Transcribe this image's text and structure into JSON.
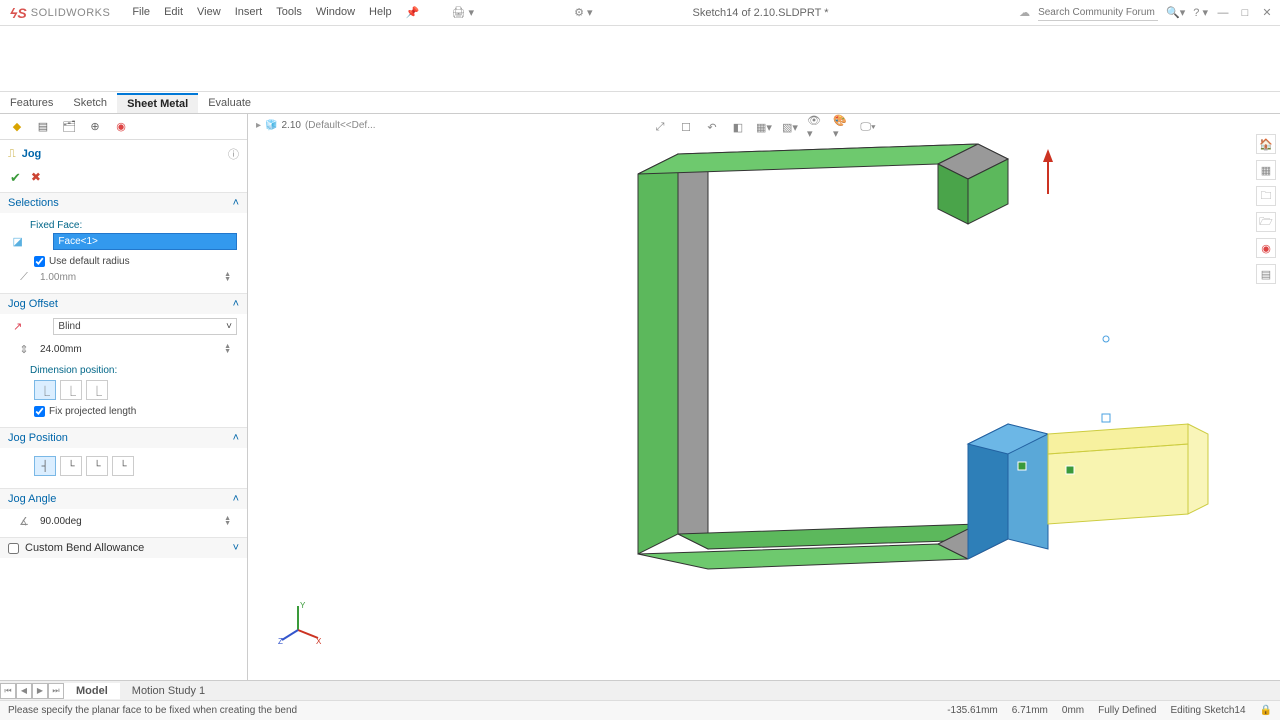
{
  "app": {
    "brand": "SOLIDWORKS",
    "doc_title": "Sketch14 of 2.10.SLDPRT *"
  },
  "menu": [
    "File",
    "Edit",
    "View",
    "Insert",
    "Tools",
    "Window",
    "Help"
  ],
  "search_placeholder": "Search Community Forum",
  "tabs": {
    "items": [
      "Features",
      "Sketch",
      "Sheet Metal",
      "Evaluate"
    ],
    "active": 2
  },
  "pm": {
    "feature_name": "Jog",
    "sections": {
      "selections": {
        "title": "Selections",
        "fixed_face_label": "Fixed Face:",
        "fixed_face_value": "Face<1>",
        "use_default_radius_label": "Use default radius",
        "radius_value": "1.00mm"
      },
      "jog_offset": {
        "title": "Jog Offset",
        "end_condition": "Blind",
        "distance": "24.00mm",
        "dim_pos_label": "Dimension position:",
        "fix_projected_label": "Fix projected length"
      },
      "jog_position": {
        "title": "Jog Position"
      },
      "jog_angle": {
        "title": "Jog Angle",
        "angle": "90.00deg"
      },
      "custom_bend": {
        "title": "Custom Bend Allowance"
      }
    }
  },
  "crumb": {
    "model": "2.10",
    "config": "(Default<<Def..."
  },
  "bottom_tabs": {
    "items": [
      "Model",
      "Motion Study 1"
    ],
    "active": 0
  },
  "status": {
    "prompt": "Please specify the planar face to be fixed when creating the bend",
    "coord_x": "-135.61mm",
    "coord_y": "6.71mm",
    "coord_z": "0mm",
    "define": "Fully Defined",
    "mode": "Editing Sketch14"
  },
  "triad": {
    "x": "X",
    "y": "Y",
    "z": "Z"
  }
}
